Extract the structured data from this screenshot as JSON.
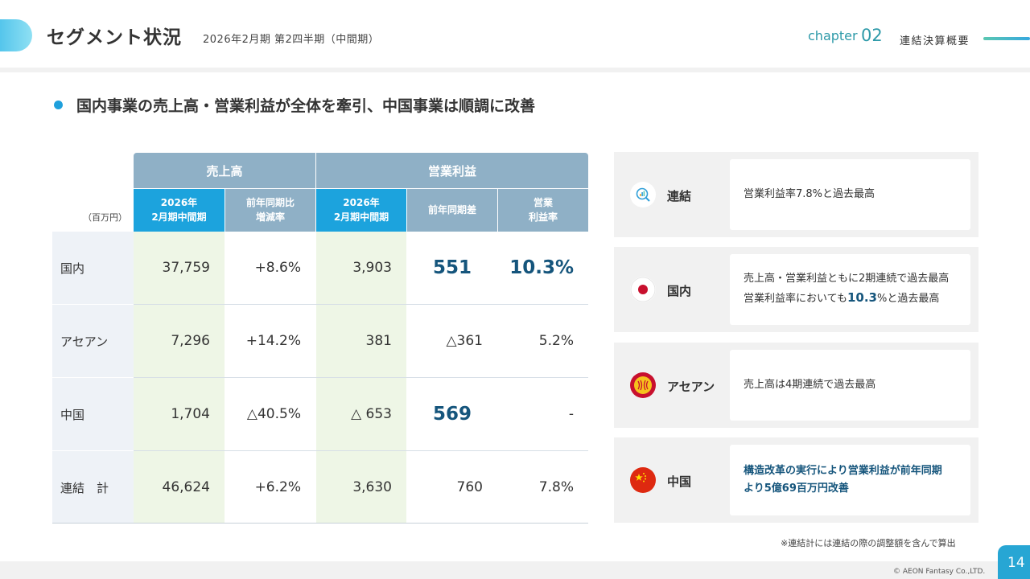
{
  "header": {
    "title": "セグメント状況",
    "subtitle": "2026年2月期 第2四半期（中間期）",
    "chapter_label": "chapter",
    "chapter_number": "02",
    "chapter_name": "連結決算概要"
  },
  "headline": "国内事業の売上高・営業利益が全体を牽引、中国事業は順調に改善",
  "table": {
    "unit": "（百万円）",
    "group_sales": "売上高",
    "group_op": "営業利益",
    "col1_l1": "2026年",
    "col1_l2": "2月期中間期",
    "col2_l1": "前年同期比",
    "col2_l2": "増減率",
    "col3_l1": "2026年",
    "col3_l2": "2月期中間期",
    "col4": "前年同期差",
    "col5_l1": "営業",
    "col5_l2": "利益率",
    "rows": [
      {
        "label": "国内",
        "sales": "37,759",
        "sales_yoy": "+8.6%",
        "op": "3,903",
        "op_diff": "551",
        "margin": "10.3%"
      },
      {
        "label": "アセアン",
        "sales": "7,296",
        "sales_yoy": "+14.2%",
        "op": "381",
        "op_diff": "△361",
        "margin": "5.2%"
      },
      {
        "label": "中国",
        "sales": "1,704",
        "sales_yoy": "△40.5%",
        "op": "△ 653",
        "op_diff": "569",
        "margin": "-"
      },
      {
        "label": "連結　計",
        "sales": "46,624",
        "sales_yoy": "+6.2%",
        "op": "3,630",
        "op_diff": "760",
        "margin": "7.8%"
      }
    ]
  },
  "panels": [
    {
      "icon": "consolidated-chart-icon",
      "label": "連結",
      "text_1": "営業利益率7.8%と過去最高"
    },
    {
      "icon": "japan-flag-icon",
      "label": "国内",
      "text_1": "売上高・営業利益ともに2期連続で過去最高",
      "text_2_pre": "営業利益率においても",
      "text_2_em": "10.3",
      "text_2_post": "%と過去最高"
    },
    {
      "icon": "asean-emblem-icon",
      "label": "アセアン",
      "text_1": "売上高は4期連続で過去最高"
    },
    {
      "icon": "china-flag-icon",
      "label": "中国",
      "text_1": "構造改革の実行により営業利益が前年同期",
      "text_2": "より5億69百万円改善"
    }
  ],
  "note": "※連結計には連結の際の調整額を含んで算出",
  "footer": {
    "copyright": "© AEON Fantasy Co.,LTD.",
    "page": "14"
  },
  "colors": {
    "accent": "#1ca3dd",
    "header_gray_blue": "#8fb0c6",
    "highlight_green": "#eef6e6",
    "emphasis_navy": "#15557c"
  }
}
